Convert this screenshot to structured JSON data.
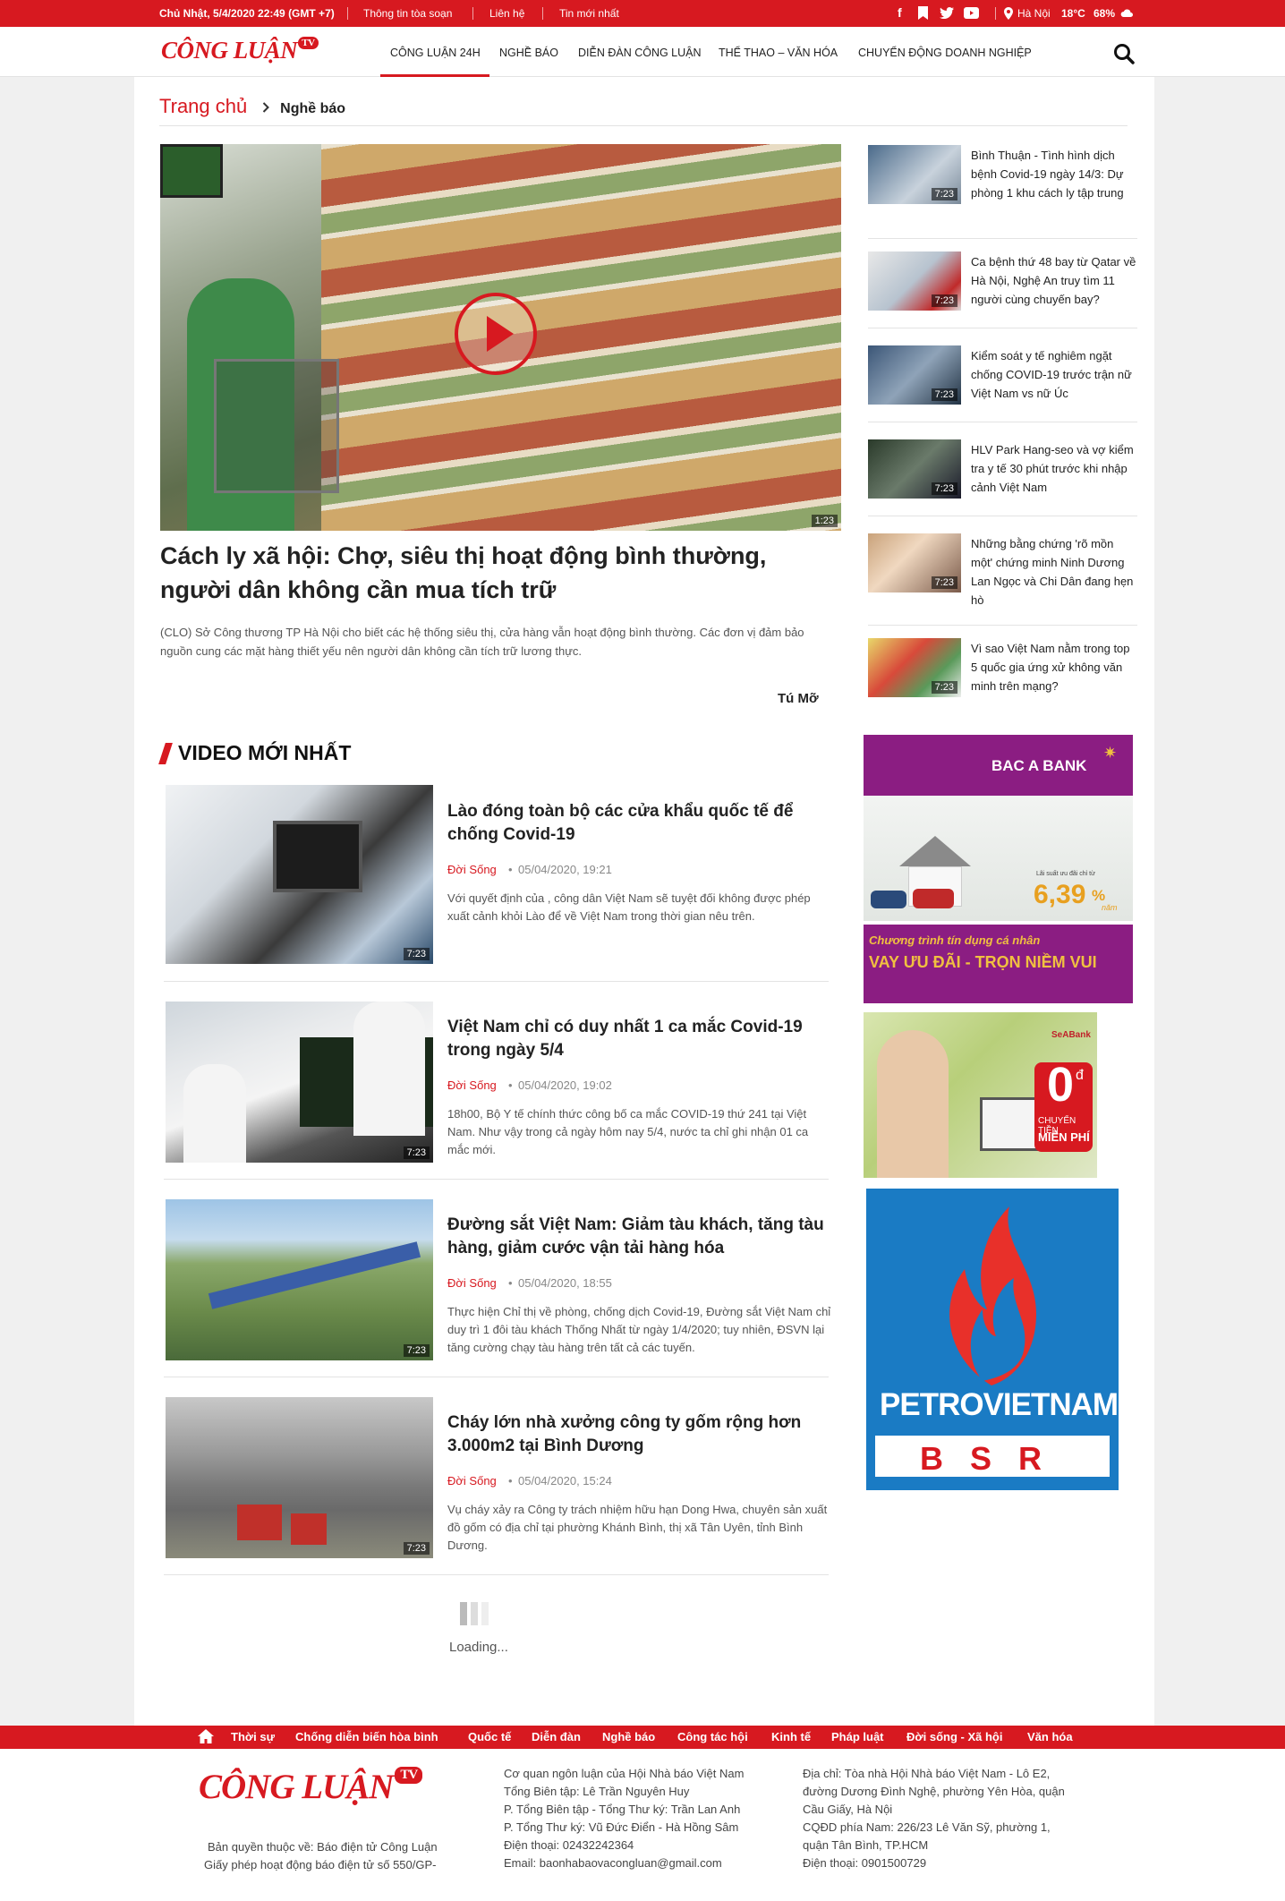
{
  "topbar": {
    "date": "Chủ Nhật, 5/4/2020 22:49 (GMT +7)",
    "links": [
      "Thông tin tòa soạn",
      "Liên hệ",
      "Tin mới nhất"
    ],
    "city": "Hà Nội",
    "temp": "18°C",
    "humidity": "68%"
  },
  "brand": {
    "logo_text": "CÔNG LUẬN",
    "logo_tv": "TV"
  },
  "nav": [
    "CÔNG LUẬN 24H",
    "NGHỀ BÁO",
    "DIỄN ĐÀN CÔNG LUẬN",
    "THỂ THAO – VĂN HÓA",
    "CHUYỂN ĐỘNG DOANH NGHIỆP"
  ],
  "breadcrumb": {
    "home": "Trang chủ",
    "current": "Nghề báo"
  },
  "featured": {
    "duration": "1:23",
    "title": "Cách ly xã hội: Chợ, siêu thị hoạt động bình thường, người dân không cần mua tích trữ",
    "summary": "(CLO) Sở Công thương TP Hà Nội cho biết các hệ thống siêu thị, cửa hàng vẫn hoạt động bình thường. Các đơn vị đảm bảo nguồn cung các mặt hàng thiết yếu nên người dân không cần tích trữ lương thực.",
    "author": "Tú Mỡ"
  },
  "sidebar": [
    {
      "title": "Bình Thuận - Tình hình dịch bệnh Covid-19 ngày 14/3: Dự phòng 1 khu cách ly tập trung",
      "duration": "7:23"
    },
    {
      "title": "Ca bệnh thứ 48 bay từ Qatar về Hà Nội, Nghệ An truy tìm 11 người cùng chuyến bay?",
      "duration": "7:23"
    },
    {
      "title": "Kiểm soát y tế nghiêm ngặt chống COVID-19 trước trận nữ Việt Nam vs nữ Úc",
      "duration": "7:23"
    },
    {
      "title": "HLV Park Hang-seo và vợ kiểm tra y tế 30 phút trước khi nhập cảnh Việt Nam",
      "duration": "7:23"
    },
    {
      "title": "Những bằng chứng 'rõ mồn một' chứng minh Ninh Dương Lan Ngọc và Chi Dân đang hẹn hò",
      "duration": "7:23"
    },
    {
      "title": "Vì sao Việt Nam nằm trong top 5 quốc gia ứng xử không văn minh trên mạng?",
      "duration": "7:23"
    }
  ],
  "video_section": {
    "heading": "VIDEO MỚI NHẤT"
  },
  "videos": [
    {
      "title": "Lào đóng toàn bộ các cửa khẩu quốc tế để chống Covid-19",
      "category": "Đời Sống",
      "date": "05/04/2020, 19:21",
      "summary": "Với quyết định của , công dân Việt Nam sẽ tuyệt đối không được phép xuất cảnh khỏi Lào để về Việt Nam trong thời gian nêu trên.",
      "duration": "7:23"
    },
    {
      "title": "Việt Nam chỉ có duy nhất 1 ca mắc Covid-19 trong ngày 5/4",
      "category": "Đời Sống",
      "date": "05/04/2020, 19:02",
      "summary": "18h00, Bộ Y tế chính thức công bố ca mắc COVID-19 thứ 241 tại Việt Nam. Như vậy trong cả ngày hôm nay 5/4, nước ta chỉ ghi nhận 01 ca mắc mới.",
      "duration": "7:23"
    },
    {
      "title": "Đường sắt Việt Nam: Giảm tàu khách, tăng tàu hàng, giảm cước vận tải hàng hóa",
      "category": "Đời Sống",
      "date": "05/04/2020, 18:55",
      "summary": "Thực hiện Chỉ thị về phòng, chống dịch Covid-19, Đường sắt Việt Nam chỉ duy trì 1 đôi tàu khách Thống Nhất từ ngày 1/4/2020; tuy nhiên, ĐSVN lại tăng cường chạy tàu hàng trên tất cả các tuyến.",
      "duration": "7:23"
    },
    {
      "title": "Cháy lớn nhà xưởng công ty gốm rộng hơn 3.000m2 tại Bình Dương",
      "category": "Đời Sống",
      "date": "05/04/2020, 15:24",
      "summary": "Vụ cháy xảy ra Công ty trách nhiệm hữu hạn Dong Hwa, chuyên sản xuất đồ gốm có địa chỉ tại phường Khánh Bình, thị xã Tân Uyên, tỉnh Bình Dương.",
      "duration": "7:23"
    }
  ],
  "loading": "Loading...",
  "ads": {
    "bacabank": {
      "brand": "BAC A BANK",
      "rate_label": "Lãi suất ưu đãi chỉ từ",
      "rate": "6,39",
      "rate_unit": "%",
      "rate_suffix": "năm",
      "line1": "Chương trình tín dụng cá nhân",
      "line2": "VAY ƯU ĐÃI - TRỌN NIỀM VUI"
    },
    "seabank": {
      "brand": "SeABank",
      "big": "0",
      "currency": "đ",
      "line1": "CHUYỂN TIỀN",
      "line2": "MIỄN PHÍ"
    },
    "petro": {
      "brand": "PETROVIETNAM",
      "sub": "BSR"
    }
  },
  "catbar": [
    "Thời sự",
    "Chống diễn biến hòa bình",
    "Quốc tế",
    "Diễn đàn",
    "Nghề báo",
    "Công tác hội",
    "Kinh tế",
    "Pháp luật",
    "Đời sống - Xã hội",
    "Văn hóa"
  ],
  "footer": {
    "copyright": [
      "Bản quyền thuộc về: Báo điện tử Công Luận",
      "Giấy phép hoạt động báo điện tử số 550/GP-"
    ],
    "col2": [
      "Cơ quan ngôn luận của Hội Nhà báo Việt Nam",
      "Tổng Biên tập: Lê Trần Nguyên Huy",
      "P. Tổng Biên tập - Tổng Thư ký: Trần Lan Anh",
      "P. Tổng Thư ký: Vũ Đức Điển - Hà Hồng Sâm",
      "Điện thoại: 02432242364",
      "Email: baonhabaovacongluan@gmail.com"
    ],
    "col3": [
      "Địa chỉ: Tòa nhà Hội Nhà báo Việt Nam - Lô E2,",
      "đường Dương Đình Nghệ, phường Yên Hòa, quận",
      "Cầu Giấy, Hà Nội",
      "CQĐD phía Nam: 226/23 Lê Văn Sỹ, phường 1,",
      "quận Tân Bình, TP.HCM",
      "Điện thoại: 0901500729"
    ]
  },
  "colors": {
    "brand_red": "#d71920",
    "bacabank_purple": "#8b1d82",
    "petro_blue": "#1a7bc4"
  }
}
